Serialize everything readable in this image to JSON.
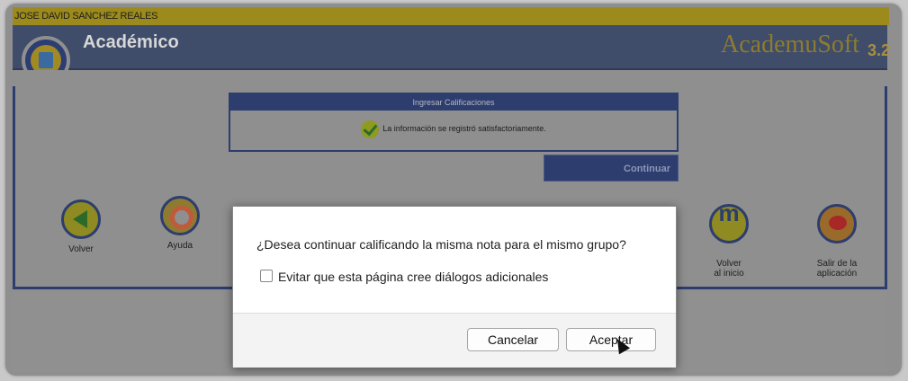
{
  "user": {
    "name": "JOSE DAVID SANCHEZ REALES"
  },
  "header": {
    "section_title": "Académico",
    "brand_name": "AcademuSoft",
    "brand_version": "3.2",
    "logo_icon": "house-icon"
  },
  "message": {
    "title": "Ingresar Calificaciones",
    "text": "La información se registró satisfactoriamente.",
    "status_icon": "check-icon"
  },
  "continue_label": "Continuar",
  "nav": [
    {
      "label": "Volver",
      "icon": "arrow-left-icon"
    },
    {
      "label": "Ayuda",
      "icon": "lifebuoy-icon"
    },
    {
      "label": "Volver\nal inicio",
      "icon": "home-m-icon"
    },
    {
      "label": "Salir de la\naplicación",
      "icon": "exit-icon"
    }
  ],
  "dialog": {
    "question": "¿Desea continuar calificando la misma nota para el mismo grupo?",
    "checkbox_label": "Evitar que esta página cree diálogos adicionales",
    "checkbox_checked": false,
    "cancel_label": "Cancelar",
    "accept_label": "Aceptar"
  },
  "colors": {
    "accent_navy": "#2c3d6e",
    "user_bar": "#9c8a1c",
    "brand": "#8e7c2e"
  }
}
